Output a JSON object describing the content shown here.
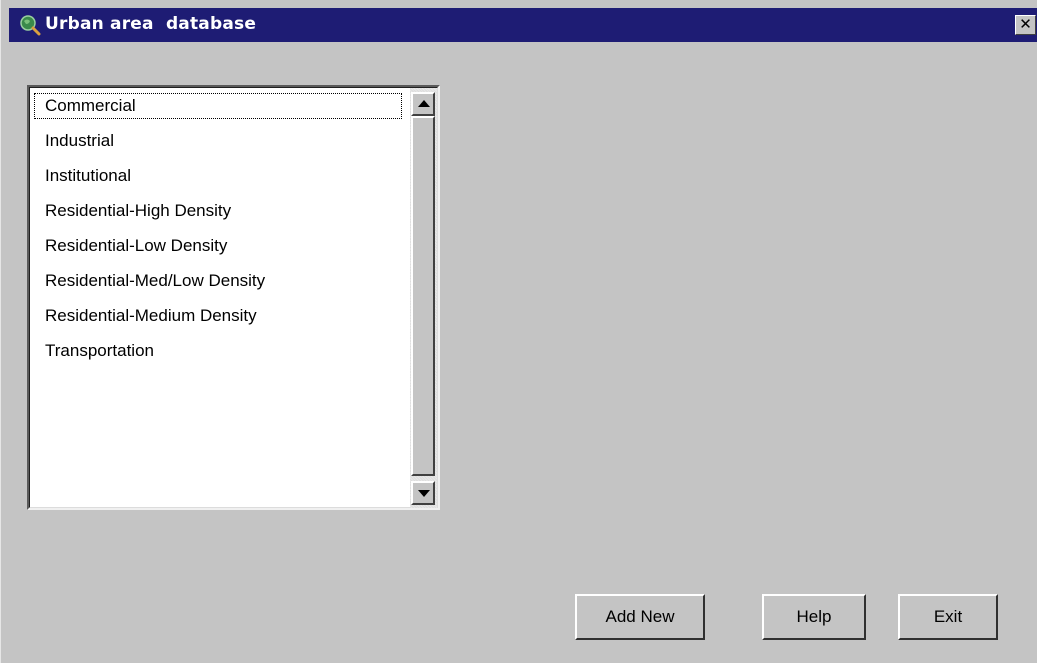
{
  "window": {
    "title": "Urban area  database",
    "close_glyph": "✕",
    "title_icon": "globe-magnifier-icon",
    "title_bar_color": "#1e1c74"
  },
  "list": {
    "items": [
      "Commercial",
      "Industrial",
      "Institutional",
      "Residential-High Density",
      "Residential-Low Density",
      "Residential-Med/Low Density",
      "Residential-Medium Density",
      "Transportation"
    ],
    "focused_item": "Commercial"
  },
  "buttons": {
    "add_new": "Add New",
    "help": "Help",
    "exit": "Exit"
  }
}
